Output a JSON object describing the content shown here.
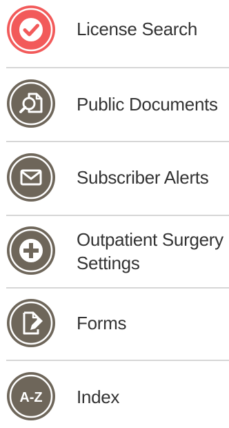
{
  "nav": {
    "items": [
      {
        "label": "License Search",
        "icon": "checkmark-icon",
        "color": "#f25a5a"
      },
      {
        "label": "Public Documents",
        "icon": "document-search-icon",
        "color": "#6e665a"
      },
      {
        "label": "Subscriber Alerts",
        "icon": "envelope-icon",
        "color": "#6e665a"
      },
      {
        "label_line1": "Outpatient Surgery",
        "label_line2": "Settings",
        "icon": "plus-icon",
        "color": "#6e665a"
      },
      {
        "label": "Forms",
        "icon": "form-pencil-icon",
        "color": "#6e665a"
      },
      {
        "label": "Index",
        "icon": "a-z-icon",
        "icon_text": "A-Z",
        "color": "#6e665a"
      }
    ]
  }
}
